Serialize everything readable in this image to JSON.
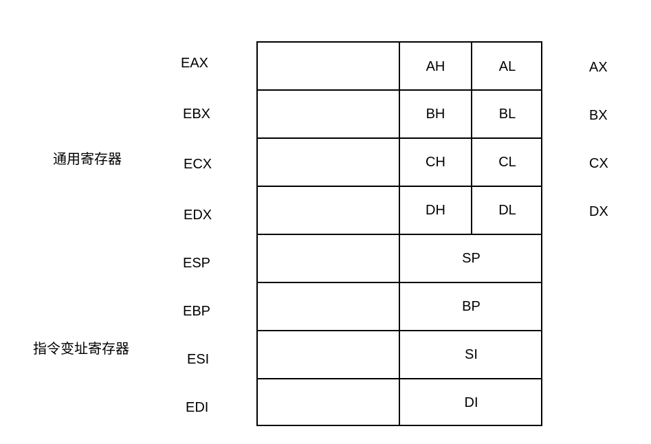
{
  "groups": {
    "general": "通用寄存器",
    "index": "指令变址寄存器"
  },
  "registers": [
    {
      "name": "EAX",
      "high": "AH",
      "low": "AL",
      "word": "AX"
    },
    {
      "name": "EBX",
      "high": "BH",
      "low": "BL",
      "word": "BX"
    },
    {
      "name": "ECX",
      "high": "CH",
      "low": "CL",
      "word": "CX"
    },
    {
      "name": "EDX",
      "high": "DH",
      "low": "DL",
      "word": "DX"
    },
    {
      "name": "ESP",
      "word16": "SP"
    },
    {
      "name": "EBP",
      "word16": "BP"
    },
    {
      "name": "ESI",
      "word16": "SI"
    },
    {
      "name": "EDI",
      "word16": "DI"
    }
  ]
}
